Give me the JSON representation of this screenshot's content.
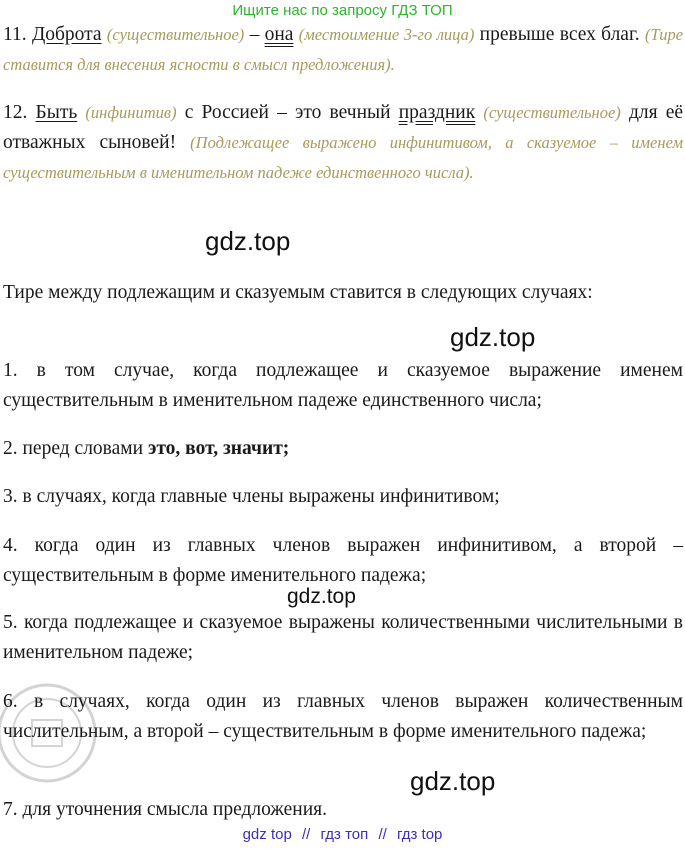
{
  "header": {
    "text": "Ищите нас по запросу ГДЗ ТОП"
  },
  "p11": {
    "num": "11.",
    "subject": "Доброта",
    "note1": "(существительное)",
    "dash": "–",
    "predicate": "она",
    "note2": "(местоимение 3-го лица)",
    "text1": "превыше всех благ.",
    "note3": "(Тире ставится для внесения ясности в смысл предложения)."
  },
  "p12": {
    "num": "12.",
    "subject": "Быть",
    "note1": "(инфинитив)",
    "text1": "с Россией – это вечный",
    "predicate": "праздник",
    "note2": "(существительное)",
    "text2": "для её отважных сыновей!",
    "note3": "(Подлежащее выражено инфинитивом, а сказуемое – именем существительным в именительном падеже единственного числа)."
  },
  "watermarks": {
    "w1": "gdz.top",
    "w2": "gdz.top",
    "w3": "gdz.top",
    "w4": "gdz.top"
  },
  "intro": "Тире между подлежащим и сказуемым ставится в следующих случаях:",
  "items": {
    "i1": "1. в том случае, когда подлежащее и сказуемое выражение именем существительным в именительном падеже единственного числа;",
    "i2_text": "2. перед словами",
    "i2_bold": "это, вот, значит;",
    "i3": "3. в случаях, когда главные члены выражены инфинитивом;",
    "i4": "4. когда один из главных членов выражен инфинитивом, а второй – существительным в форме именительного падежа;",
    "i5": "5. когда подлежащее и сказуемое выражены количественными числительными в именительном падеже;",
    "i6": "6. в случаях, когда один из главных членов выражен количественным числительным, а второй – существительным в форме именительного падежа;",
    "i7": "7. для уточнения смысла предложения."
  },
  "footer": {
    "a": "gdz top",
    "sep1": "//",
    "b": "гдз топ",
    "sep2": "//",
    "c": "гдз top"
  }
}
